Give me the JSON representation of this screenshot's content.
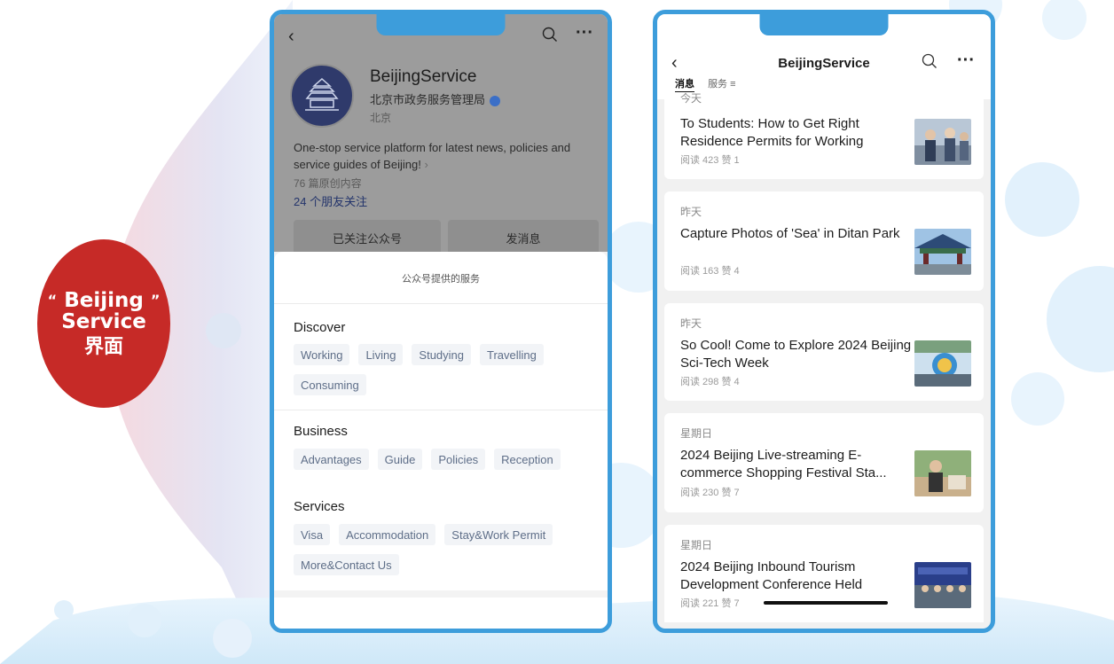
{
  "badge": {
    "line1": "Beijing",
    "line2": "Service",
    "line3": "界面",
    "open_quote": "“",
    "close_quote": "”"
  },
  "left_phone": {
    "profile": {
      "name": "BeijingService",
      "org": "北京市政务服务管理局",
      "location": "北京",
      "description": "One-stop service platform for latest news, policies and service guides of Beijing!",
      "original_count": "76 篇原创内容",
      "friends_following": "24 个朋友关注",
      "follow_button": "已关注公众号",
      "message_button": "发消息",
      "icons": [
        "back-arrow-icon",
        "search-icon",
        "more-icon",
        "verified-icon"
      ]
    },
    "services_sheet": {
      "title": "公众号提供的服务",
      "sections": [
        {
          "title": "Discover",
          "items": [
            "Working",
            "Living",
            "Studying",
            "Travelling",
            "Consuming"
          ]
        },
        {
          "title": "Business",
          "items": [
            "Advantages",
            "Guide",
            "Policies",
            "Reception"
          ]
        },
        {
          "title": "Services",
          "items": [
            "Visa",
            "Accommodation",
            "Stay&Work Permit",
            "More&Contact Us"
          ]
        }
      ]
    }
  },
  "right_phone": {
    "title": "BeijingService",
    "tabs": [
      {
        "label": "消息",
        "active": true
      },
      {
        "label": "服务 ≡",
        "active": false
      }
    ],
    "icons": [
      "back-arrow-icon",
      "search-icon",
      "more-icon"
    ],
    "articles": [
      {
        "date": "今天",
        "title": "To Students: How to Get Right Residence Permits for Working",
        "stats": "阅读 423  赞 1"
      },
      {
        "date": "昨天",
        "title": "Capture Photos of 'Sea' in Ditan Park",
        "stats": "阅读 163  赞 4"
      },
      {
        "date": "昨天",
        "title": "So Cool! Come to Explore 2024 Beijing Sci-Tech Week",
        "stats": "阅读 298  赞 4"
      },
      {
        "date": "星期日",
        "title": "2024 Beijing Live-streaming E-commerce Shopping Festival Sta...",
        "stats": "阅读 230  赞 7"
      },
      {
        "date": "星期日",
        "title": "2024 Beijing Inbound Tourism Development Conference Held",
        "stats": "阅读 221  赞 7"
      }
    ]
  },
  "colors": {
    "phone_border": "#3d9ddb",
    "badge": "#c62a27",
    "chip_bg": "#f2f4f7",
    "chip_text": "#5e6e88"
  }
}
